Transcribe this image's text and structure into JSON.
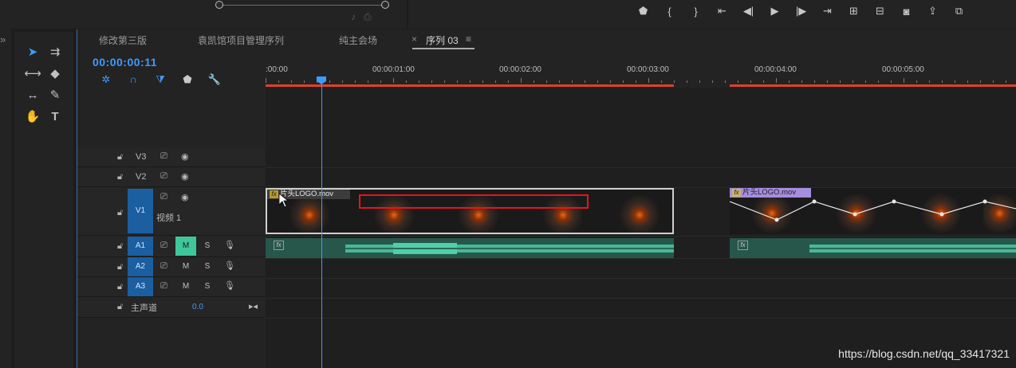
{
  "tabs": [
    "修改第三版",
    "袁凯馆项目管理序列",
    "纯主会场",
    "序列 03"
  ],
  "tab_close": "×",
  "tab_menu": "≡",
  "timecode": "00:00:00:11",
  "ruler": {
    "labels": [
      ":00:00",
      "00:00:01:00",
      "00:00:02:00",
      "00:00:03:00",
      "00:00:04:00",
      "00:00:05:00"
    ]
  },
  "tracks": {
    "v3": "V3",
    "v2": "V2",
    "v1_badge": "V1",
    "v1_label": "V1",
    "v1_name": "视频 1",
    "a1_badge": "A1",
    "a2_badge": "A2",
    "a3_badge": "A3",
    "mute": "M",
    "solo": "S",
    "master_label": "主声道",
    "master_value": "0.0"
  },
  "clips": {
    "clip1_name": "片头LOGO.mov",
    "clip2_name": "片头LOGO.mov",
    "fx": "fx"
  },
  "icons": {
    "left_expand": "»",
    "lock": "🔓"
  },
  "watermark": "https://blog.csdn.net/qq_33417321",
  "colors": {
    "accent": "#3d9bff",
    "work_area": "#e0412a",
    "audio_clip": "#26574a",
    "mute_on": "#3ec79a",
    "highlight_box": "#e8141b",
    "clip_label_v": "#a58de0"
  }
}
